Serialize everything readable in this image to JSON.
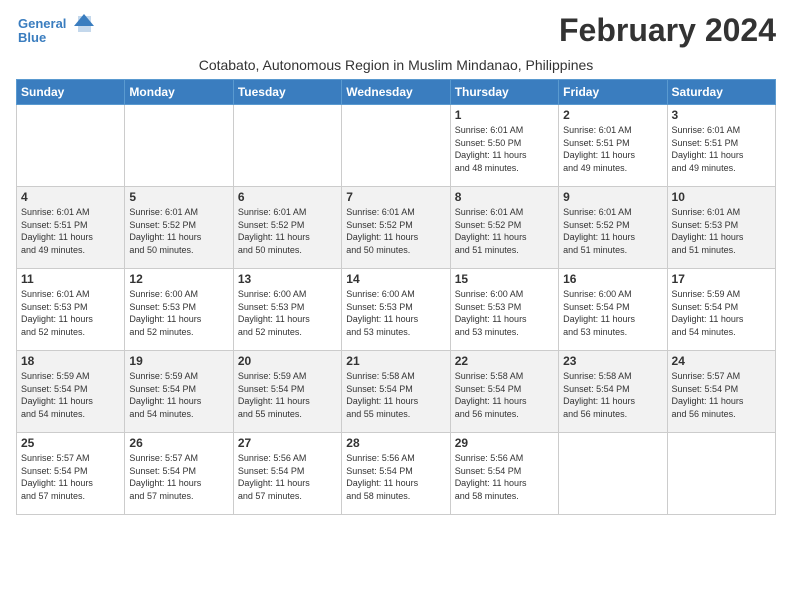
{
  "header": {
    "logo_line1": "General",
    "logo_line2": "Blue",
    "month_title": "February 2024",
    "subtitle": "Cotabato, Autonomous Region in Muslim Mindanao, Philippines"
  },
  "days_of_week": [
    "Sunday",
    "Monday",
    "Tuesday",
    "Wednesday",
    "Thursday",
    "Friday",
    "Saturday"
  ],
  "weeks": [
    [
      {
        "day": "",
        "info": ""
      },
      {
        "day": "",
        "info": ""
      },
      {
        "day": "",
        "info": ""
      },
      {
        "day": "",
        "info": ""
      },
      {
        "day": "1",
        "info": "Sunrise: 6:01 AM\nSunset: 5:50 PM\nDaylight: 11 hours\nand 48 minutes."
      },
      {
        "day": "2",
        "info": "Sunrise: 6:01 AM\nSunset: 5:51 PM\nDaylight: 11 hours\nand 49 minutes."
      },
      {
        "day": "3",
        "info": "Sunrise: 6:01 AM\nSunset: 5:51 PM\nDaylight: 11 hours\nand 49 minutes."
      }
    ],
    [
      {
        "day": "4",
        "info": "Sunrise: 6:01 AM\nSunset: 5:51 PM\nDaylight: 11 hours\nand 49 minutes."
      },
      {
        "day": "5",
        "info": "Sunrise: 6:01 AM\nSunset: 5:52 PM\nDaylight: 11 hours\nand 50 minutes."
      },
      {
        "day": "6",
        "info": "Sunrise: 6:01 AM\nSunset: 5:52 PM\nDaylight: 11 hours\nand 50 minutes."
      },
      {
        "day": "7",
        "info": "Sunrise: 6:01 AM\nSunset: 5:52 PM\nDaylight: 11 hours\nand 50 minutes."
      },
      {
        "day": "8",
        "info": "Sunrise: 6:01 AM\nSunset: 5:52 PM\nDaylight: 11 hours\nand 51 minutes."
      },
      {
        "day": "9",
        "info": "Sunrise: 6:01 AM\nSunset: 5:52 PM\nDaylight: 11 hours\nand 51 minutes."
      },
      {
        "day": "10",
        "info": "Sunrise: 6:01 AM\nSunset: 5:53 PM\nDaylight: 11 hours\nand 51 minutes."
      }
    ],
    [
      {
        "day": "11",
        "info": "Sunrise: 6:01 AM\nSunset: 5:53 PM\nDaylight: 11 hours\nand 52 minutes."
      },
      {
        "day": "12",
        "info": "Sunrise: 6:00 AM\nSunset: 5:53 PM\nDaylight: 11 hours\nand 52 minutes."
      },
      {
        "day": "13",
        "info": "Sunrise: 6:00 AM\nSunset: 5:53 PM\nDaylight: 11 hours\nand 52 minutes."
      },
      {
        "day": "14",
        "info": "Sunrise: 6:00 AM\nSunset: 5:53 PM\nDaylight: 11 hours\nand 53 minutes."
      },
      {
        "day": "15",
        "info": "Sunrise: 6:00 AM\nSunset: 5:53 PM\nDaylight: 11 hours\nand 53 minutes."
      },
      {
        "day": "16",
        "info": "Sunrise: 6:00 AM\nSunset: 5:54 PM\nDaylight: 11 hours\nand 53 minutes."
      },
      {
        "day": "17",
        "info": "Sunrise: 5:59 AM\nSunset: 5:54 PM\nDaylight: 11 hours\nand 54 minutes."
      }
    ],
    [
      {
        "day": "18",
        "info": "Sunrise: 5:59 AM\nSunset: 5:54 PM\nDaylight: 11 hours\nand 54 minutes."
      },
      {
        "day": "19",
        "info": "Sunrise: 5:59 AM\nSunset: 5:54 PM\nDaylight: 11 hours\nand 54 minutes."
      },
      {
        "day": "20",
        "info": "Sunrise: 5:59 AM\nSunset: 5:54 PM\nDaylight: 11 hours\nand 55 minutes."
      },
      {
        "day": "21",
        "info": "Sunrise: 5:58 AM\nSunset: 5:54 PM\nDaylight: 11 hours\nand 55 minutes."
      },
      {
        "day": "22",
        "info": "Sunrise: 5:58 AM\nSunset: 5:54 PM\nDaylight: 11 hours\nand 56 minutes."
      },
      {
        "day": "23",
        "info": "Sunrise: 5:58 AM\nSunset: 5:54 PM\nDaylight: 11 hours\nand 56 minutes."
      },
      {
        "day": "24",
        "info": "Sunrise: 5:57 AM\nSunset: 5:54 PM\nDaylight: 11 hours\nand 56 minutes."
      }
    ],
    [
      {
        "day": "25",
        "info": "Sunrise: 5:57 AM\nSunset: 5:54 PM\nDaylight: 11 hours\nand 57 minutes."
      },
      {
        "day": "26",
        "info": "Sunrise: 5:57 AM\nSunset: 5:54 PM\nDaylight: 11 hours\nand 57 minutes."
      },
      {
        "day": "27",
        "info": "Sunrise: 5:56 AM\nSunset: 5:54 PM\nDaylight: 11 hours\nand 57 minutes."
      },
      {
        "day": "28",
        "info": "Sunrise: 5:56 AM\nSunset: 5:54 PM\nDaylight: 11 hours\nand 58 minutes."
      },
      {
        "day": "29",
        "info": "Sunrise: 5:56 AM\nSunset: 5:54 PM\nDaylight: 11 hours\nand 58 minutes."
      },
      {
        "day": "",
        "info": ""
      },
      {
        "day": "",
        "info": ""
      }
    ]
  ]
}
